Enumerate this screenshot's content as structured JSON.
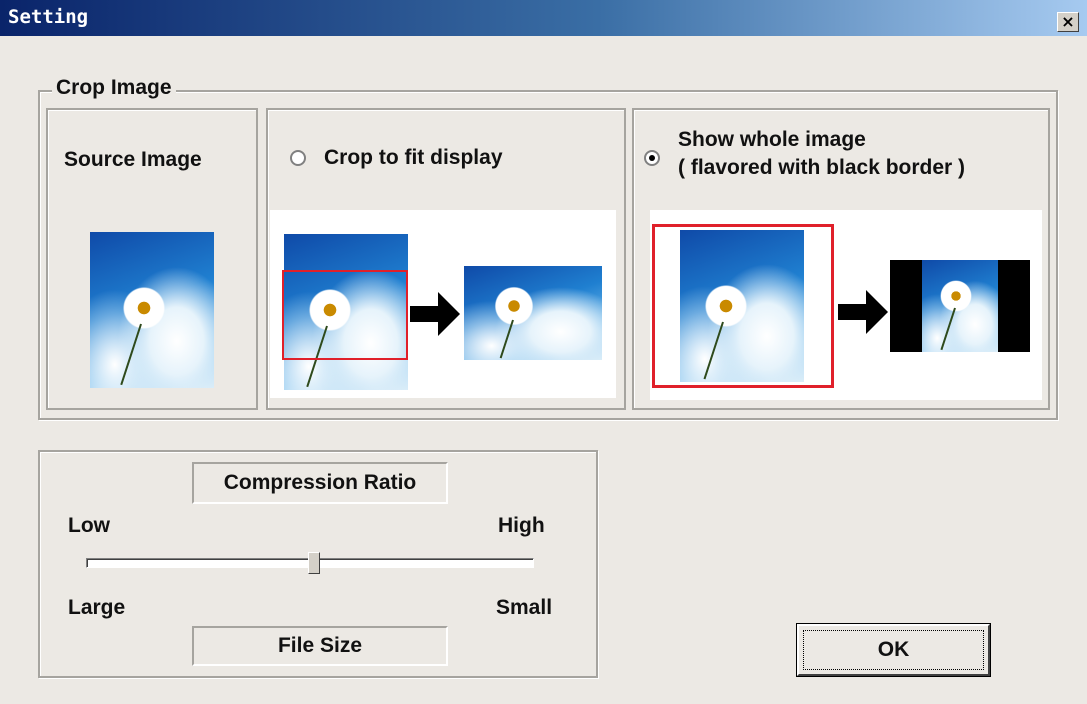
{
  "window": {
    "title": "Setting",
    "close_label": "×"
  },
  "crop_group": {
    "legend": "Crop Image",
    "source_label": "Source Image",
    "option_crop": {
      "label": "Crop to fit display",
      "selected": false
    },
    "option_whole": {
      "label_line1": "Show whole image",
      "label_line2": "( flavored with black border )",
      "selected": true
    }
  },
  "compression": {
    "ratio_label": "Compression Ratio",
    "low_label": "Low",
    "high_label": "High",
    "large_label": "Large",
    "small_label": "Small",
    "file_size_label": "File Size",
    "slider_value_fraction": 0.51
  },
  "ok_label": "OK",
  "colors": {
    "title_gradient_start": "#0a246a",
    "highlight_red": "#e0202a",
    "dialog_bg": "#ece9e4"
  }
}
